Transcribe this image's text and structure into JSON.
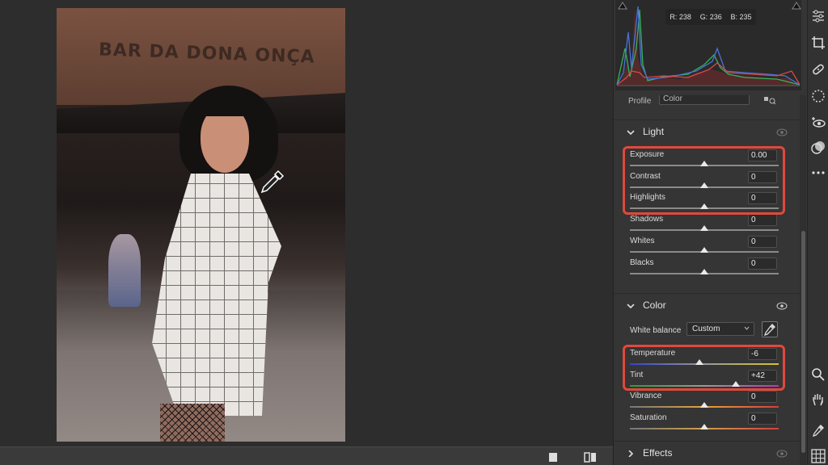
{
  "photo": {
    "sign_text": "BAR DA DONA ONÇA"
  },
  "histogram": {
    "r_label": "R:",
    "r": "238",
    "g_label": "G:",
    "g": "236",
    "b_label": "B:",
    "b": "235"
  },
  "profile": {
    "label": "Profile",
    "value": "Color"
  },
  "light": {
    "title": "Light",
    "sliders": [
      {
        "label": "Exposure",
        "value": "0.00",
        "position": 0.5
      },
      {
        "label": "Contrast",
        "value": "0",
        "position": 0.5
      },
      {
        "label": "Highlights",
        "value": "0",
        "position": 0.5
      },
      {
        "label": "Shadows",
        "value": "0",
        "position": 0.5
      },
      {
        "label": "Whites",
        "value": "0",
        "position": 0.5
      },
      {
        "label": "Blacks",
        "value": "0",
        "position": 0.5
      }
    ]
  },
  "color": {
    "title": "Color",
    "white_balance_label": "White balance",
    "white_balance_value": "Custom",
    "sliders": [
      {
        "label": "Temperature",
        "value": "-6",
        "position": 0.47
      },
      {
        "label": "Tint",
        "value": "+42",
        "position": 0.71
      },
      {
        "label": "Vibrance",
        "value": "0",
        "position": 0.5
      },
      {
        "label": "Saturation",
        "value": "0",
        "position": 0.5
      }
    ]
  },
  "effects": {
    "title": "Effects"
  },
  "colors": {
    "highlight": "#e0493b",
    "panel_bg": "#353535",
    "canvas_bg": "#2d2d2d"
  }
}
